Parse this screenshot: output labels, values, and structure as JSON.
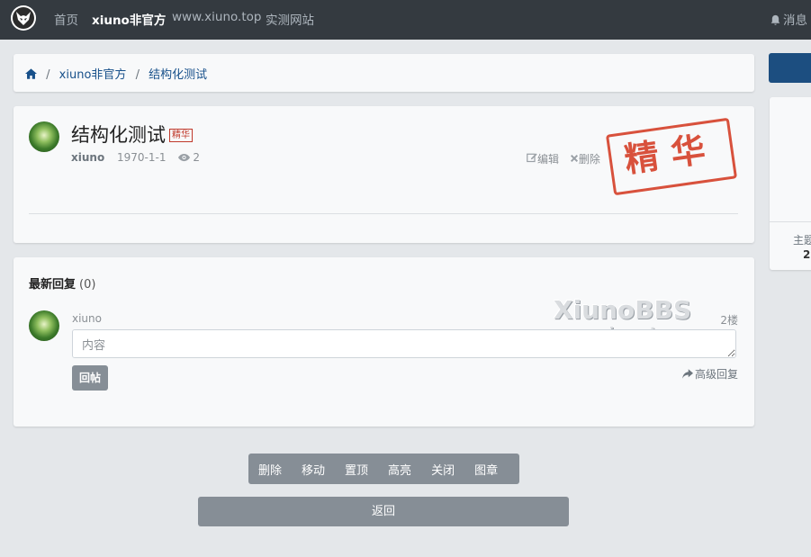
{
  "navbar": {
    "links": [
      {
        "label": "首页"
      },
      {
        "label": "xiuno非官方"
      },
      {
        "label": "www.xiuno.top"
      },
      {
        "label": "实测网站"
      }
    ],
    "messages_label": "消息"
  },
  "breadcrumb": {
    "items": [
      "xiuno非官方",
      "结构化测试"
    ],
    "separator": "/"
  },
  "thread": {
    "title": "结构化测试",
    "badge": "精华",
    "author": "xiuno",
    "date": "1970-1-1",
    "views": "2",
    "edit_label": "编辑",
    "delete_label": "删除",
    "stamp_text": "精华"
  },
  "replies": {
    "title": "最新回复",
    "count": "(0)",
    "user": "xiuno",
    "floor": "2楼",
    "input_placeholder": "内容",
    "submit_label": "回帖",
    "advanced_label": "高级回复",
    "watermark_title": "XiunoBBS",
    "watermark_url": "www.xiuno.top"
  },
  "moderation": {
    "buttons": [
      "删除",
      "移动",
      "置顶",
      "高亮",
      "关闭",
      "图章"
    ]
  },
  "back_label": "返回",
  "sidebar": {
    "stat_label": "主题",
    "stat_value": "2"
  },
  "colors": {
    "navbar": "#343a40",
    "accent": "#1c4e80",
    "stamp": "#d43a22",
    "button_gray": "#868e96"
  }
}
